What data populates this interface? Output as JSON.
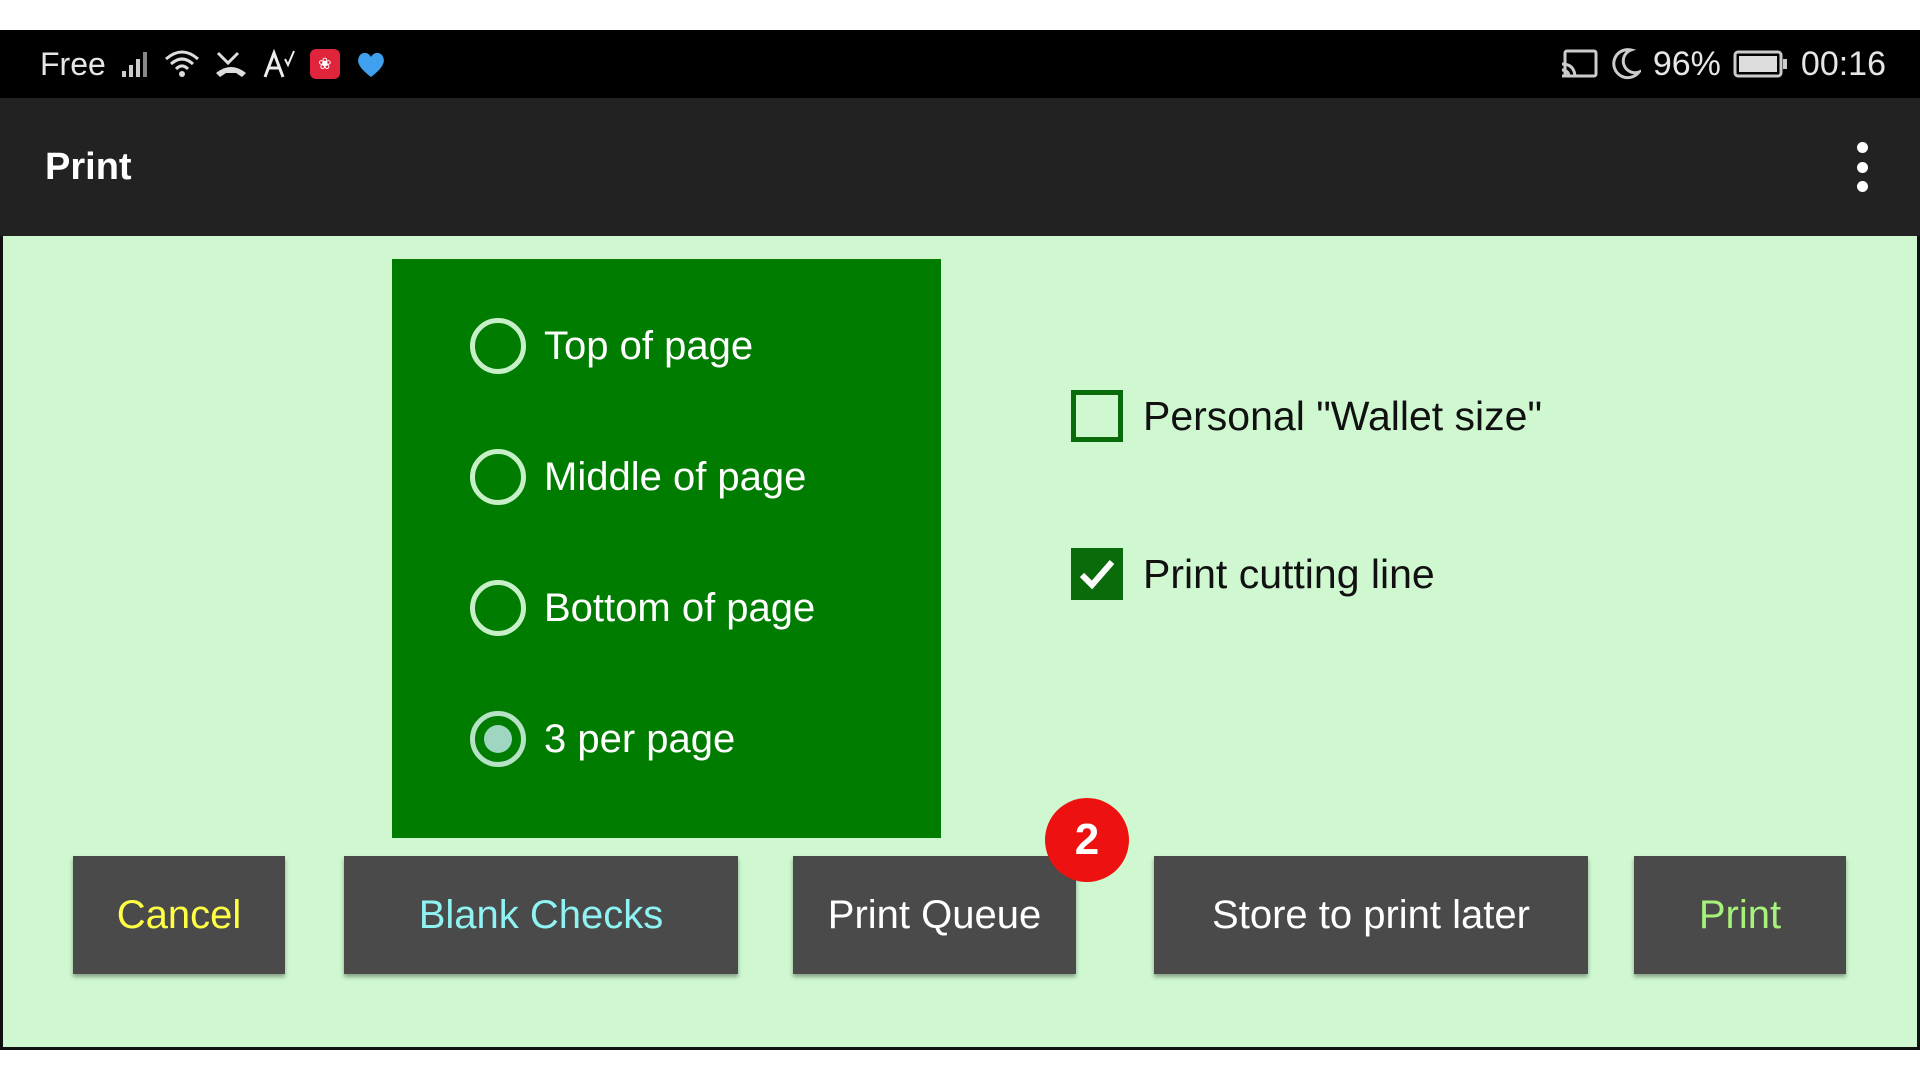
{
  "status_bar": {
    "carrier": "Free",
    "battery_percent": "96%",
    "time": "00:16",
    "icons": [
      "signal-icon",
      "wifi-icon",
      "missed-call-icon",
      "font-size-icon",
      "huawei-app-icon",
      "health-app-icon",
      "cast-icon",
      "moon-icon",
      "battery-icon"
    ]
  },
  "app_bar": {
    "title": "Print"
  },
  "position_options": [
    {
      "label": "Top of page",
      "selected": false
    },
    {
      "label": "Middle of page",
      "selected": false
    },
    {
      "label": "Bottom of page",
      "selected": false
    },
    {
      "label": "3 per page",
      "selected": true
    }
  ],
  "checkboxes": [
    {
      "label": "Personal \"Wallet size\"",
      "checked": false
    },
    {
      "label": "Print cutting line",
      "checked": true
    }
  ],
  "buttons": {
    "cancel": "Cancel",
    "blank_checks": "Blank Checks",
    "print_queue": "Print Queue",
    "print_queue_badge": "2",
    "store_later": "Store to print later",
    "print": "Print"
  },
  "colors": {
    "content_bg": "#cff8d0",
    "group_bg": "#007d00",
    "cancel_text": "#ffff44",
    "blank_text": "#8ff3f3",
    "print_text": "#a6f27a",
    "badge": "#ee1111"
  }
}
